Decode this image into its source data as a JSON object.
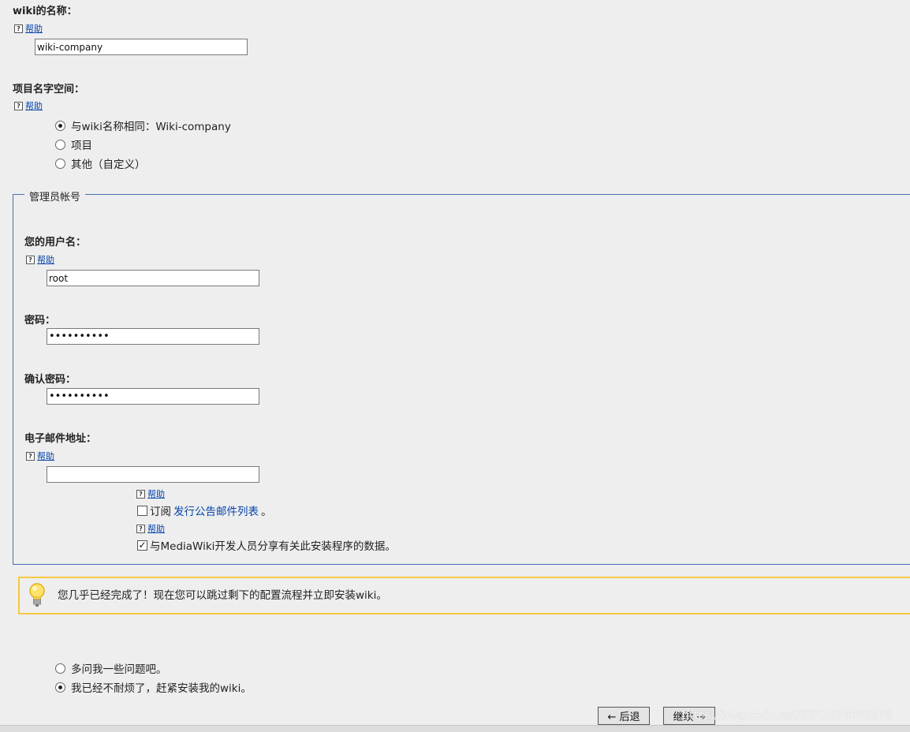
{
  "wiki_name": {
    "label": "wiki的名称：",
    "help": "帮助",
    "value": "wiki-company"
  },
  "namespace": {
    "label": "项目名字空间：",
    "help": "帮助",
    "options": [
      {
        "label": "与wiki名称相同：Wiki-company",
        "checked": true
      },
      {
        "label": "项目",
        "checked": false
      },
      {
        "label": "其他（自定义）",
        "checked": false
      }
    ]
  },
  "admin": {
    "legend": "管理员帐号",
    "username": {
      "label": "您的用户名：",
      "help": "帮助",
      "value": "root"
    },
    "password": {
      "label": "密码：",
      "value": "••••••••••"
    },
    "confirm_password": {
      "label": "确认密码：",
      "value": "••••••••••"
    },
    "email": {
      "label": "电子邮件地址：",
      "help": "帮助",
      "value": ""
    },
    "subscribe": {
      "help": "帮助",
      "prefix": "订阅",
      "link": "发行公告邮件列表",
      "suffix": "。",
      "checked": false
    },
    "share": {
      "help": "帮助",
      "label": "与MediaWiki开发人员分享有关此安装程序的数据。",
      "checked": true
    }
  },
  "notice": {
    "icon": "lightbulb-icon",
    "text": "您几乎已经完成了！现在您可以跳过剩下的配置流程并立即安装wiki。"
  },
  "choice": {
    "options": [
      {
        "label": "多问我一些问题吧。",
        "checked": false
      },
      {
        "label": "我已经不耐烦了，赶紧安装我的wiki。",
        "checked": true
      }
    ]
  },
  "buttons": {
    "back": "← 后退",
    "continue": "继续 →"
  },
  "watermark": "https://blog.csdn.net/ZZY1078689276",
  "colors": {
    "background": "#eeeeee",
    "link": "#0645ad",
    "fieldset_border": "#4a6fb0",
    "notice_border": "#f5c842"
  }
}
